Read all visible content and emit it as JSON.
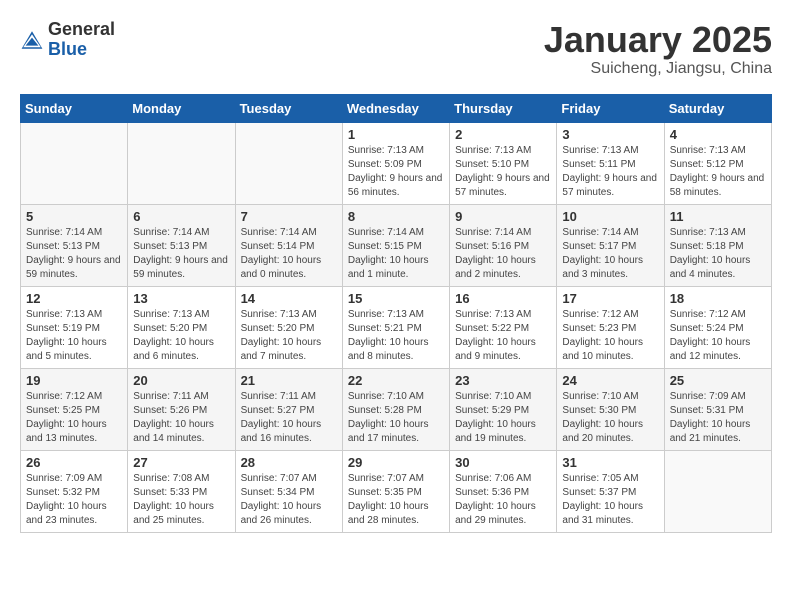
{
  "header": {
    "logo_general": "General",
    "logo_blue": "Blue",
    "month_title": "January 2025",
    "location": "Suicheng, Jiangsu, China"
  },
  "days_of_week": [
    "Sunday",
    "Monday",
    "Tuesday",
    "Wednesday",
    "Thursday",
    "Friday",
    "Saturday"
  ],
  "weeks": [
    [
      {
        "day": "",
        "info": ""
      },
      {
        "day": "",
        "info": ""
      },
      {
        "day": "",
        "info": ""
      },
      {
        "day": "1",
        "info": "Sunrise: 7:13 AM\nSunset: 5:09 PM\nDaylight: 9 hours and 56 minutes."
      },
      {
        "day": "2",
        "info": "Sunrise: 7:13 AM\nSunset: 5:10 PM\nDaylight: 9 hours and 57 minutes."
      },
      {
        "day": "3",
        "info": "Sunrise: 7:13 AM\nSunset: 5:11 PM\nDaylight: 9 hours and 57 minutes."
      },
      {
        "day": "4",
        "info": "Sunrise: 7:13 AM\nSunset: 5:12 PM\nDaylight: 9 hours and 58 minutes."
      }
    ],
    [
      {
        "day": "5",
        "info": "Sunrise: 7:14 AM\nSunset: 5:13 PM\nDaylight: 9 hours and 59 minutes."
      },
      {
        "day": "6",
        "info": "Sunrise: 7:14 AM\nSunset: 5:13 PM\nDaylight: 9 hours and 59 minutes."
      },
      {
        "day": "7",
        "info": "Sunrise: 7:14 AM\nSunset: 5:14 PM\nDaylight: 10 hours and 0 minutes."
      },
      {
        "day": "8",
        "info": "Sunrise: 7:14 AM\nSunset: 5:15 PM\nDaylight: 10 hours and 1 minute."
      },
      {
        "day": "9",
        "info": "Sunrise: 7:14 AM\nSunset: 5:16 PM\nDaylight: 10 hours and 2 minutes."
      },
      {
        "day": "10",
        "info": "Sunrise: 7:14 AM\nSunset: 5:17 PM\nDaylight: 10 hours and 3 minutes."
      },
      {
        "day": "11",
        "info": "Sunrise: 7:13 AM\nSunset: 5:18 PM\nDaylight: 10 hours and 4 minutes."
      }
    ],
    [
      {
        "day": "12",
        "info": "Sunrise: 7:13 AM\nSunset: 5:19 PM\nDaylight: 10 hours and 5 minutes."
      },
      {
        "day": "13",
        "info": "Sunrise: 7:13 AM\nSunset: 5:20 PM\nDaylight: 10 hours and 6 minutes."
      },
      {
        "day": "14",
        "info": "Sunrise: 7:13 AM\nSunset: 5:20 PM\nDaylight: 10 hours and 7 minutes."
      },
      {
        "day": "15",
        "info": "Sunrise: 7:13 AM\nSunset: 5:21 PM\nDaylight: 10 hours and 8 minutes."
      },
      {
        "day": "16",
        "info": "Sunrise: 7:13 AM\nSunset: 5:22 PM\nDaylight: 10 hours and 9 minutes."
      },
      {
        "day": "17",
        "info": "Sunrise: 7:12 AM\nSunset: 5:23 PM\nDaylight: 10 hours and 10 minutes."
      },
      {
        "day": "18",
        "info": "Sunrise: 7:12 AM\nSunset: 5:24 PM\nDaylight: 10 hours and 12 minutes."
      }
    ],
    [
      {
        "day": "19",
        "info": "Sunrise: 7:12 AM\nSunset: 5:25 PM\nDaylight: 10 hours and 13 minutes."
      },
      {
        "day": "20",
        "info": "Sunrise: 7:11 AM\nSunset: 5:26 PM\nDaylight: 10 hours and 14 minutes."
      },
      {
        "day": "21",
        "info": "Sunrise: 7:11 AM\nSunset: 5:27 PM\nDaylight: 10 hours and 16 minutes."
      },
      {
        "day": "22",
        "info": "Sunrise: 7:10 AM\nSunset: 5:28 PM\nDaylight: 10 hours and 17 minutes."
      },
      {
        "day": "23",
        "info": "Sunrise: 7:10 AM\nSunset: 5:29 PM\nDaylight: 10 hours and 19 minutes."
      },
      {
        "day": "24",
        "info": "Sunrise: 7:10 AM\nSunset: 5:30 PM\nDaylight: 10 hours and 20 minutes."
      },
      {
        "day": "25",
        "info": "Sunrise: 7:09 AM\nSunset: 5:31 PM\nDaylight: 10 hours and 21 minutes."
      }
    ],
    [
      {
        "day": "26",
        "info": "Sunrise: 7:09 AM\nSunset: 5:32 PM\nDaylight: 10 hours and 23 minutes."
      },
      {
        "day": "27",
        "info": "Sunrise: 7:08 AM\nSunset: 5:33 PM\nDaylight: 10 hours and 25 minutes."
      },
      {
        "day": "28",
        "info": "Sunrise: 7:07 AM\nSunset: 5:34 PM\nDaylight: 10 hours and 26 minutes."
      },
      {
        "day": "29",
        "info": "Sunrise: 7:07 AM\nSunset: 5:35 PM\nDaylight: 10 hours and 28 minutes."
      },
      {
        "day": "30",
        "info": "Sunrise: 7:06 AM\nSunset: 5:36 PM\nDaylight: 10 hours and 29 minutes."
      },
      {
        "day": "31",
        "info": "Sunrise: 7:05 AM\nSunset: 5:37 PM\nDaylight: 10 hours and 31 minutes."
      },
      {
        "day": "",
        "info": ""
      }
    ]
  ]
}
